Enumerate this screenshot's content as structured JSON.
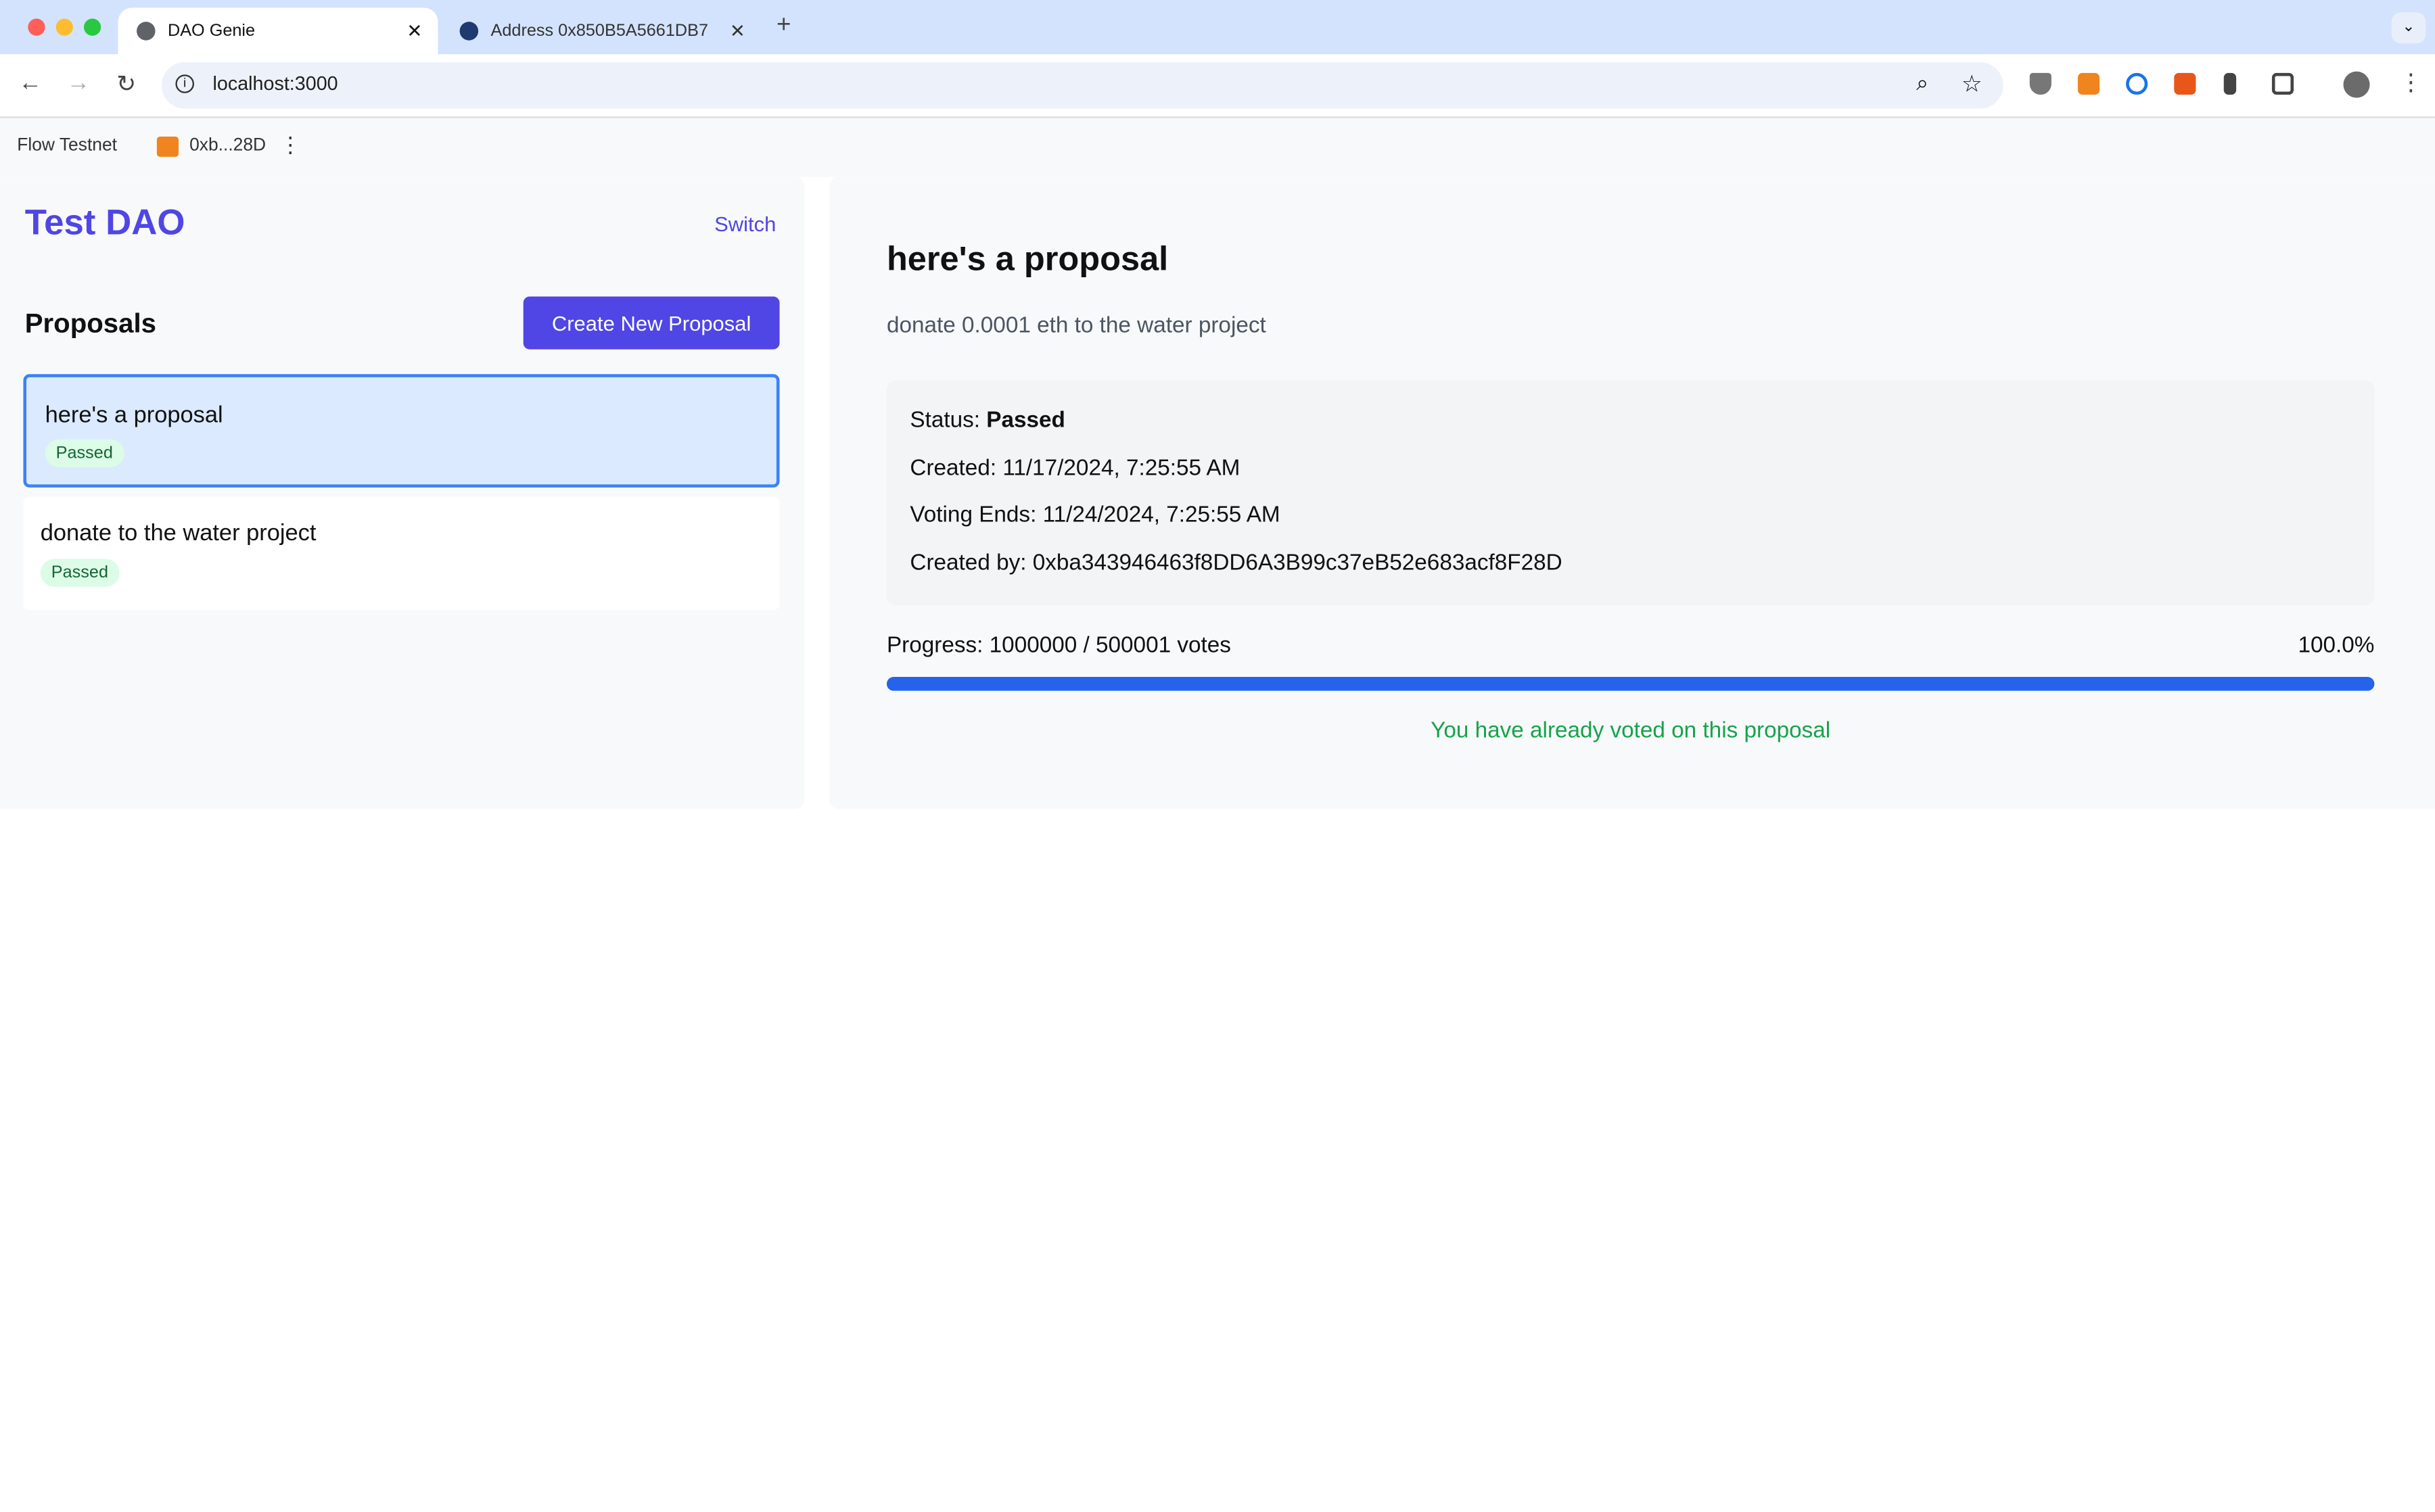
{
  "browser": {
    "tabs": [
      {
        "title": "DAO Genie",
        "active": true
      },
      {
        "title": "Address 0x850B5A5661DB7"
      }
    ],
    "url": "localhost:3000",
    "bookmarks": [
      {
        "label": "Flow Testnet"
      },
      {
        "label": "0xb...28D"
      }
    ],
    "extension_icons": [
      "zoom-icon",
      "star-icon",
      "ublock-icon",
      "metamask-icon",
      "1password-icon",
      "private-internet-access-icon",
      "keys-icon",
      "puzzle-icon",
      "avatar",
      "more-icon"
    ]
  },
  "sidebar": {
    "dao_name": "Test DAO",
    "switch_label": "Switch",
    "proposals_heading": "Proposals",
    "create_label": "Create New Proposal",
    "proposals": [
      {
        "title": "here's a proposal",
        "status": "Passed",
        "selected": true
      },
      {
        "title": "donate to the water project",
        "status": "Passed"
      }
    ]
  },
  "detail": {
    "title": "here's a proposal",
    "description": "donate 0.0001 eth to the water project",
    "status_label": "Status:",
    "status": "Passed",
    "created": "Created: 11/17/2024, 7:25:55 AM",
    "voting_ends": "Voting Ends: 11/24/2024, 7:25:55 AM",
    "created_by": "Created by: 0xba343946463f8DD6A3B99c37eB52e683acf8F28D",
    "progress_text": "Progress: 1000000 / 500001 votes",
    "progress_percent": "100.0%",
    "progress_fraction": 1.0,
    "voted_message": "You have already voted on this proposal"
  },
  "colors": {
    "accent": "#4f46e5",
    "progress": "#2563eb",
    "success": "#16a34a"
  }
}
